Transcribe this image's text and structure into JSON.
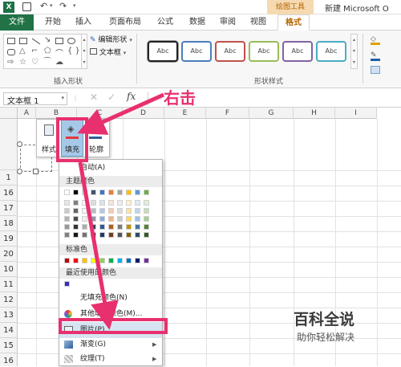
{
  "title_bar": {
    "title": "新建 Microsoft O"
  },
  "tabs": {
    "file": "文件",
    "home": "开始",
    "insert": "插入",
    "layout": "页面布局",
    "formulas": "公式",
    "data": "数据",
    "review": "审阅",
    "view": "视图",
    "context_group": "绘图工具",
    "format": "格式"
  },
  "ribbon": {
    "edit_shape": "编辑形状",
    "text_box": "文本框",
    "insert_shapes_group": "插入形状",
    "shape_styles_group": "形状样式",
    "style_sample": "Abc",
    "style_colors": [
      "#222222",
      "#4a7ebb",
      "#c0504d",
      "#9bbb59",
      "#8064a2",
      "#4bacc6"
    ]
  },
  "formula_bar": {
    "name_box": "文本框 1",
    "fx": "fx"
  },
  "annotation": {
    "text": "右击"
  },
  "columns": [
    "A",
    "B",
    "C",
    "D",
    "E",
    "F",
    "G",
    "H",
    "I"
  ],
  "rows": [
    "",
    "1",
    "16",
    "17",
    "18",
    "19",
    "20",
    "10",
    "11",
    "12",
    "13",
    "14",
    "15",
    "16",
    "17"
  ],
  "mini_toolbar": {
    "style": "样式",
    "fill": "填充",
    "outline": "轮廓"
  },
  "fill_menu": {
    "auto": "自动(A)",
    "theme_colors": "主题颜色",
    "standard_colors": "标准色",
    "recent_colors": "最近使用的颜色",
    "no_fill": "无填充颜色(N)",
    "more_colors": "其他填充颜色(M)...",
    "picture": "图片(P)...",
    "gradient": "渐变(G)",
    "texture": "纹理(T)",
    "theme_top_row": [
      "#ffffff",
      "#000000",
      "#e7e6e6",
      "#44546a",
      "#4472c4",
      "#ed7d31",
      "#a5a5a5",
      "#ffc000",
      "#5b9bd5",
      "#70ad47"
    ],
    "standard_row": [
      "#c00000",
      "#ff0000",
      "#ffc000",
      "#ffff00",
      "#92d050",
      "#00b050",
      "#00b0f0",
      "#0070c0",
      "#002060",
      "#7030a0"
    ],
    "recent_row": [
      "#3a2fb8"
    ]
  },
  "watermark": {
    "main": "百科全说",
    "sub": "助你轻松解决"
  }
}
